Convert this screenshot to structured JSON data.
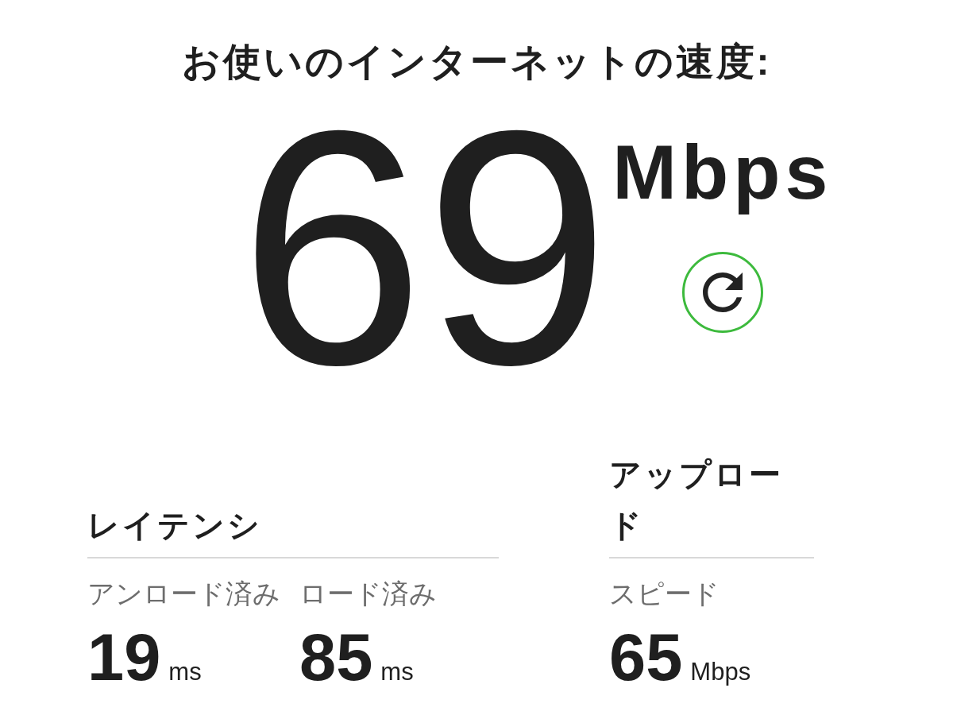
{
  "title": "お使いのインターネットの速度:",
  "speed": {
    "value": "69",
    "unit": "Mbps"
  },
  "sections": [
    {
      "heading": "レイテンシ",
      "metrics": [
        {
          "label": "アンロード済み",
          "value": "19",
          "unit": "ms"
        },
        {
          "label": "ロード済み",
          "value": "85",
          "unit": "ms"
        }
      ]
    },
    {
      "heading": "アップロード",
      "metrics": [
        {
          "label": "スピード",
          "value": "65",
          "unit": "Mbps"
        }
      ]
    }
  ]
}
